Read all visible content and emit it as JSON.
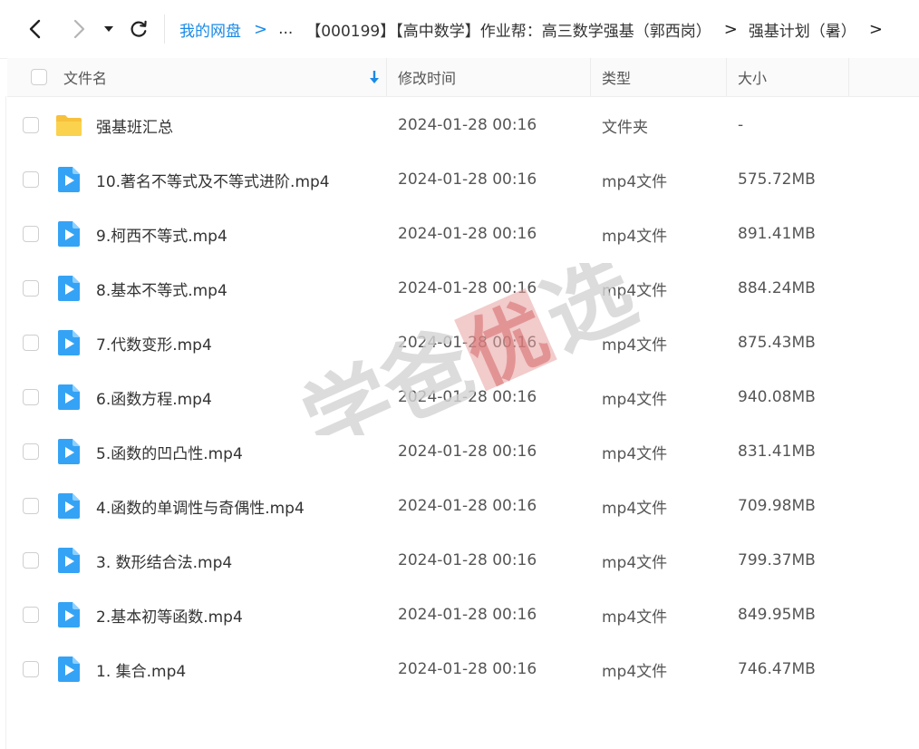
{
  "breadcrumb": {
    "root": "我的网盘",
    "ellipsis": "...",
    "items": [
      "【000199】【高中数学】作业帮：高三数学强基（郭西岗）",
      "强基计划（暑）"
    ]
  },
  "header": {
    "name": "文件名",
    "modified": "修改时间",
    "type": "类型",
    "size": "大小"
  },
  "files": [
    {
      "name": "强基班汇总",
      "modified": "2024-01-28 00:16",
      "type": "文件夹",
      "size": "-",
      "icon": "folder-icon"
    },
    {
      "name": "10.著名不等式及不等式进阶.mp4",
      "modified": "2024-01-28 00:16",
      "type": "mp4文件",
      "size": "575.72MB",
      "icon": "video-file-icon"
    },
    {
      "name": "9.柯西不等式.mp4",
      "modified": "2024-01-28 00:16",
      "type": "mp4文件",
      "size": "891.41MB",
      "icon": "video-file-icon"
    },
    {
      "name": "8.基本不等式.mp4",
      "modified": "2024-01-28 00:16",
      "type": "mp4文件",
      "size": "884.24MB",
      "icon": "video-file-icon"
    },
    {
      "name": "7.代数变形.mp4",
      "modified": "2024-01-28 00:16",
      "type": "mp4文件",
      "size": "875.43MB",
      "icon": "video-file-icon"
    },
    {
      "name": "6.函数方程.mp4",
      "modified": "2024-01-28 00:16",
      "type": "mp4文件",
      "size": "940.08MB",
      "icon": "video-file-icon"
    },
    {
      "name": "5.函数的凹凸性.mp4",
      "modified": "2024-01-28 00:16",
      "type": "mp4文件",
      "size": "831.41MB",
      "icon": "video-file-icon"
    },
    {
      "name": "4.函数的单调性与奇偶性.mp4",
      "modified": "2024-01-28 00:16",
      "type": "mp4文件",
      "size": "709.98MB",
      "icon": "video-file-icon"
    },
    {
      "name": "3. 数形结合法.mp4",
      "modified": "2024-01-28 00:16",
      "type": "mp4文件",
      "size": "799.37MB",
      "icon": "video-file-icon"
    },
    {
      "name": "2.基本初等函数.mp4",
      "modified": "2024-01-28 00:16",
      "type": "mp4文件",
      "size": "849.95MB",
      "icon": "video-file-icon"
    },
    {
      "name": "1. 集合.mp4",
      "modified": "2024-01-28 00:16",
      "type": "mp4文件",
      "size": "746.47MB",
      "icon": "video-file-icon"
    }
  ],
  "watermark": {
    "text": "学爸优选"
  },
  "colors": {
    "link": "#1a8ae6",
    "folder": "#f7c13b",
    "video": "#35a3f5",
    "watermark_text": "#cfcfcf",
    "watermark_seal": "#e07a7a"
  }
}
